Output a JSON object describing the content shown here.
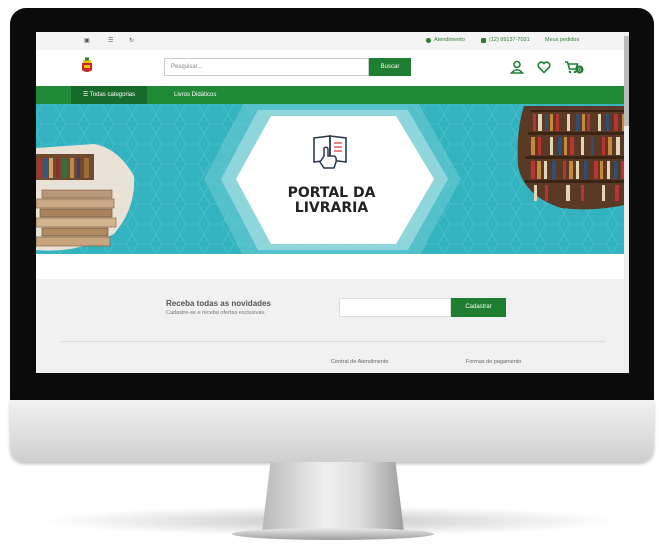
{
  "topbar": {
    "contact_label": "Atendimento",
    "phone": "(12) 99137-7031",
    "orders_label": "Meus pedidos"
  },
  "header": {
    "search_placeholder": "Pesquisar...",
    "search_button": "Buscar",
    "cart_count": "0"
  },
  "nav": {
    "all_categories": "☰ Todas categorias",
    "item": "Livros Didáticos"
  },
  "banner": {
    "title_line1": "PORTAL DA",
    "title_line2": "LIVRARIA"
  },
  "newsletter": {
    "title": "Receba todas as novidades",
    "subtitle": "Cadastre-se e receba ofertas exclusivas.",
    "button": "Cadastrar"
  },
  "footer": {
    "col1": "Central de Atendimento",
    "col2": "Formas de pagamento"
  },
  "colors": {
    "brand_green": "#1f8a36",
    "banner_teal": "#33b3bf"
  }
}
